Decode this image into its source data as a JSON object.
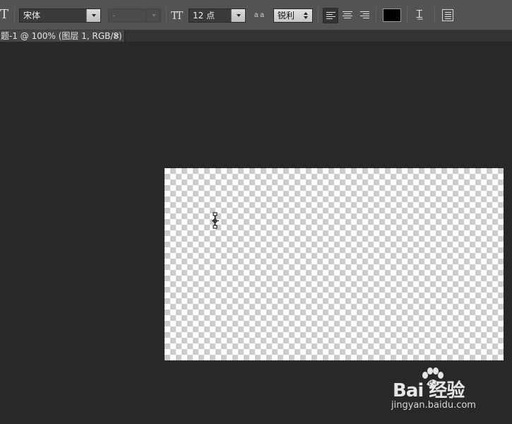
{
  "options_bar": {
    "font_family": "宋体",
    "font_style": "-",
    "font_size": "12 点",
    "antialias": "锐利",
    "aa_icon_text": "a a",
    "color_swatch": "#000000"
  },
  "document_tab": {
    "title": "题-1 @ 100% (图层 1, RGB/8)",
    "close": "×"
  },
  "canvas": {
    "transparency_colors": [
      "#ffffff",
      "#cccccc"
    ]
  },
  "watermark": {
    "logo": "Bai 经验",
    "url": "jingyan.baidu.com"
  }
}
